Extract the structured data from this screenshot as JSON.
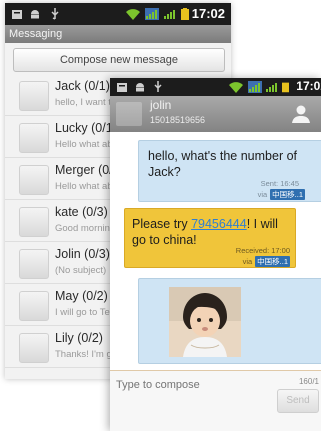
{
  "statusbar": {
    "time": "17:02",
    "icons": [
      "notification-icon",
      "android-icon",
      "usb-icon",
      "wifi-icon",
      "signal-icon",
      "signal-icon",
      "battery-icon"
    ]
  },
  "list_screen": {
    "title": "Messaging",
    "compose_label": "Compose new message",
    "conversations": [
      {
        "name": "Jack  (0/1)",
        "snippet": "hello, I want t"
      },
      {
        "name": "Lucky  (0/1",
        "snippet": "Hello what ab"
      },
      {
        "name": "Merger  (0/",
        "snippet": "Hello what ab"
      },
      {
        "name": "kate  (0/3)",
        "snippet": "Good morning"
      },
      {
        "name": "Jolin  (0/3)",
        "snippet": "(No subject)"
      },
      {
        "name": "May  (0/2)",
        "snippet": "I will go to Tel"
      },
      {
        "name": "Lily  (0/2)",
        "snippet": "Thanks! I'm g"
      }
    ]
  },
  "conversation_screen": {
    "contact_name": "jolin",
    "contact_phone": "15018519656",
    "messages": [
      {
        "text_line1": "hello, what's the number of",
        "text_line2": "Jack?",
        "status": "Sent: 16:45",
        "via": "via",
        "carrier": "中国移..1"
      },
      {
        "text_pre": "Please try ",
        "link": "79456444",
        "text_post": "! I will",
        "text_line2": "go to china!",
        "status": "Received: 17:00",
        "via": "via",
        "carrier": "中国移..1"
      }
    ],
    "compose": {
      "placeholder": "Type to compose",
      "char_count": "160/1",
      "send_label": "Send"
    }
  },
  "colors": {
    "sent_bubble": "#cfe4f4",
    "received_bubble": "#f0c53a",
    "statusbar": "#1c1c1c",
    "wifi_green": "#7cc52d"
  }
}
